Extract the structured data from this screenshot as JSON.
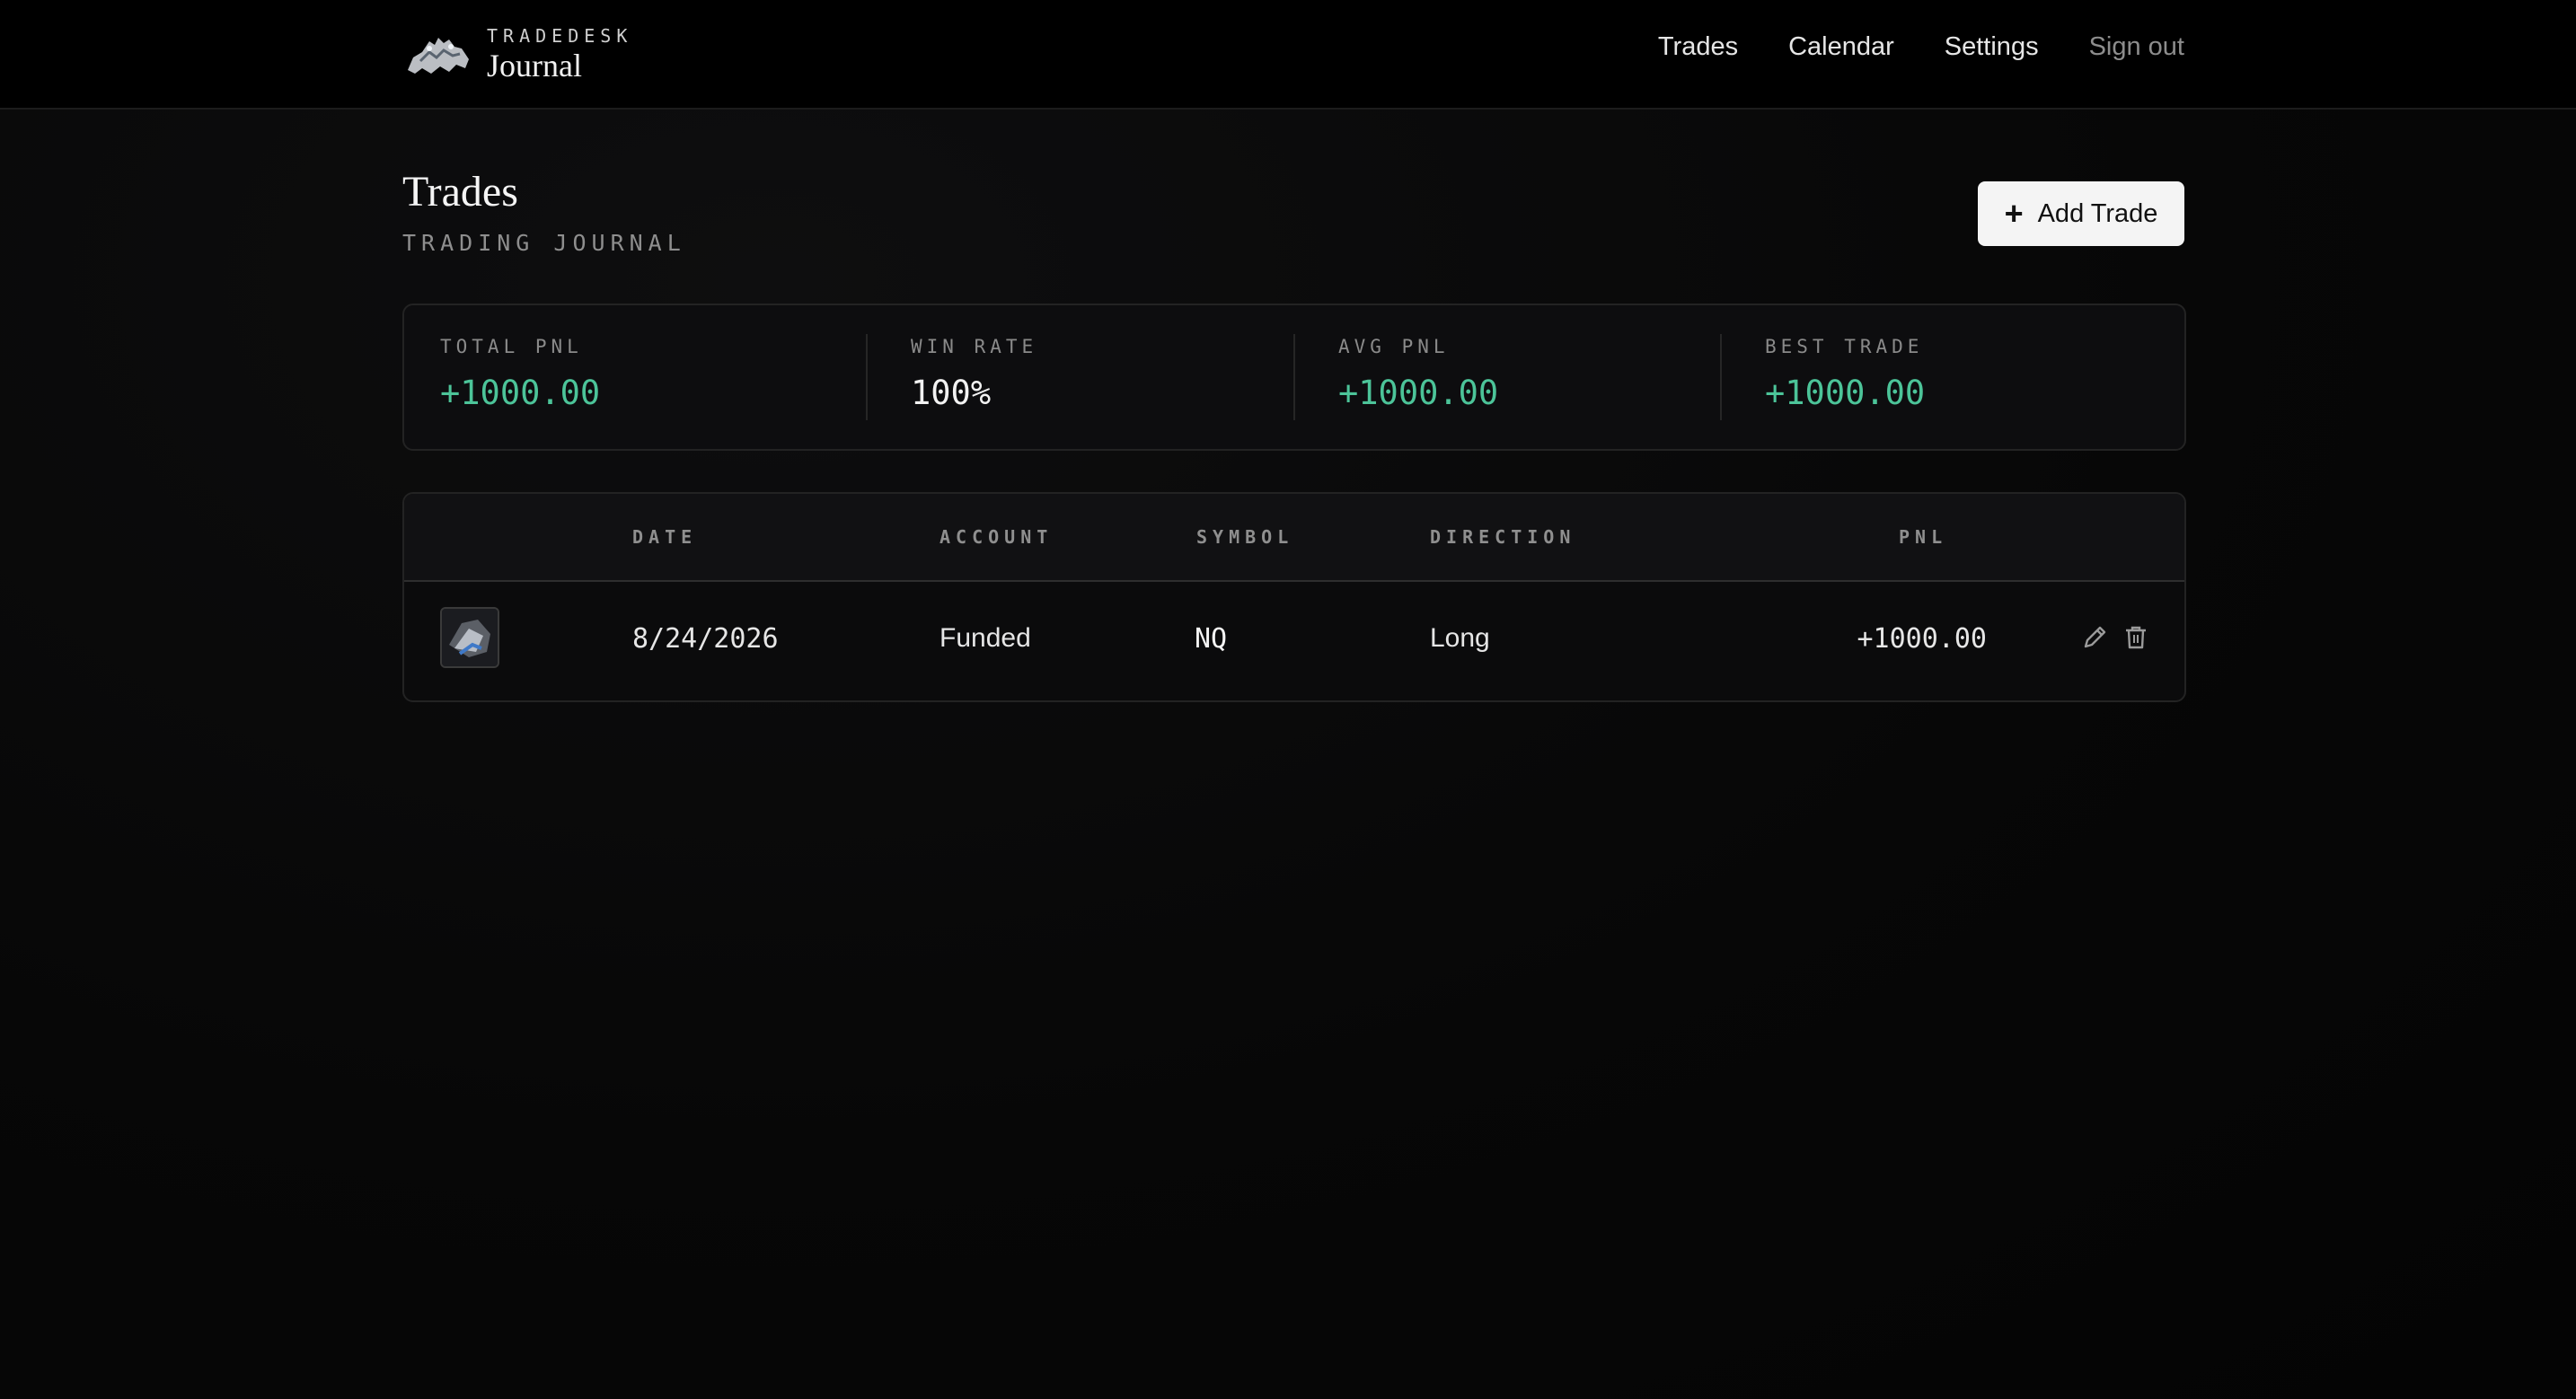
{
  "brand": {
    "kicker": "TRADEDESK",
    "title": "Journal",
    "logo_icon": "bull-bear-logo-icon"
  },
  "nav": {
    "items": [
      {
        "label": "Trades"
      },
      {
        "label": "Calendar"
      },
      {
        "label": "Settings"
      },
      {
        "label": "Sign out"
      }
    ]
  },
  "header": {
    "title": "Trades",
    "subtitle": "TRADING JOURNAL",
    "add_button": "Add Trade",
    "add_icon": "plus-icon"
  },
  "stats": [
    {
      "label": "TOTAL PNL",
      "value": "+1000.00"
    },
    {
      "label": "WIN RATE",
      "value": "100%"
    },
    {
      "label": "AVG PNL",
      "value": "+1000.00"
    },
    {
      "label": "BEST TRADE",
      "value": "+1000.00"
    }
  ],
  "table": {
    "columns": [
      "DATE",
      "ACCOUNT",
      "SYMBOL",
      "DIRECTION",
      "PNL"
    ],
    "rows": [
      {
        "date": "8/24/2026",
        "account": "Funded",
        "symbol": "NQ",
        "direction": "Long",
        "pnl": "+1000.00",
        "thumbnail_icon": "chart-screenshot-icon",
        "edit_icon": "pencil-icon",
        "delete_icon": "trash-icon"
      }
    ]
  },
  "colors": {
    "positive": "#4cc499",
    "background": "#050505",
    "button_bg": "#f4f4f4"
  }
}
